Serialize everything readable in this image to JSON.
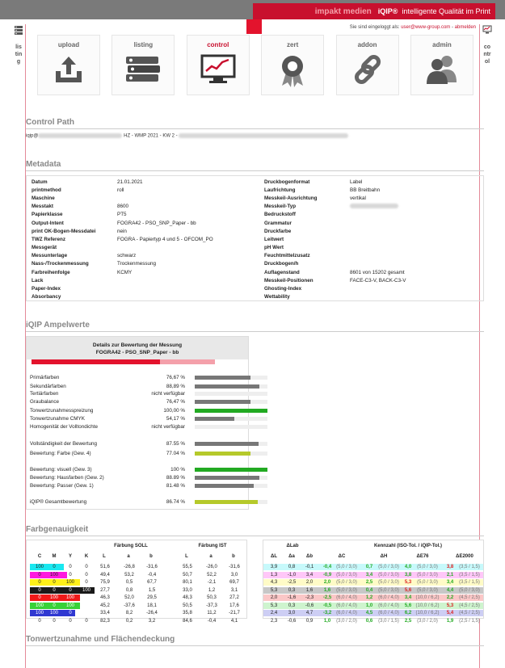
{
  "header": {
    "brand_left": "impakt medien",
    "brand_product": "iQIP®",
    "brand_tagline": "intelligente Qualität im Print"
  },
  "login": {
    "label": "Sie sind eingeloggt als:",
    "user": "user@www-group.com",
    "sep": "-",
    "logout": "abmelden"
  },
  "rails": {
    "left_label": "listing",
    "right_label": "control"
  },
  "nav": {
    "tiles": [
      {
        "label": "upload",
        "icon": "upload-icon",
        "active": false
      },
      {
        "label": "listing",
        "icon": "binders-icon",
        "active": false
      },
      {
        "label": "control",
        "icon": "monitor-chart-icon",
        "active": true
      },
      {
        "label": "zert",
        "icon": "certificate-icon",
        "active": false
      },
      {
        "label": "addon",
        "icon": "chain-link-icon",
        "active": false
      },
      {
        "label": "admin",
        "icon": "users-icon",
        "active": false
      }
    ]
  },
  "control_path": {
    "title": "Control Path",
    "prefix": "iqip@",
    "visible": "HZ - WMP 2021 - KW 2 -"
  },
  "metadata": {
    "title": "Metadata",
    "left": [
      {
        "k": "Datum",
        "v": "21.01.2021"
      },
      {
        "k": "printmethod",
        "v": "roll"
      },
      {
        "k": "Maschine",
        "v": ""
      },
      {
        "k": "Messtakt",
        "v": "8600"
      },
      {
        "k": "Papierklasse",
        "v": "PT5"
      },
      {
        "k": "Output-Intent",
        "v": "FOGRA42 - PSO_SNP_Paper - bb"
      },
      {
        "k": "print OK-Bogen-Messdatei",
        "v": "nein"
      },
      {
        "k": "TWZ Referenz",
        "v": "FOGRA - Papiertyp 4 und 5 - OFCOM_PO"
      },
      {
        "k": "Messgerät",
        "v": ""
      },
      {
        "k": "Messunterlage",
        "v": "schwarz"
      },
      {
        "k": "Nass-/Trockenmessung",
        "v": "Trockenmessung"
      },
      {
        "k": "Farbreihenfolge",
        "v": "KCMY"
      },
      {
        "k": "Lack",
        "v": ""
      },
      {
        "k": "Paper-Index",
        "v": ""
      },
      {
        "k": "Absorbancy",
        "v": ""
      }
    ],
    "right": [
      {
        "k": "Druckbogenformat",
        "v": "Label"
      },
      {
        "k": "Laufrichtung",
        "v": "BB Breitbahn"
      },
      {
        "k": "Messkeil-Ausrichtung",
        "v": "vertikal"
      },
      {
        "k": "Messkeil-Typ",
        "v": ""
      },
      {
        "k": "Bedruckstoff",
        "v": ""
      },
      {
        "k": "Grammatur",
        "v": ""
      },
      {
        "k": "Druckfarbe",
        "v": ""
      },
      {
        "k": "Leitwert",
        "v": ""
      },
      {
        "k": "pH Wert",
        "v": ""
      },
      {
        "k": "Feuchtmittelzusatz",
        "v": ""
      },
      {
        "k": "Druckbogen/h",
        "v": ""
      },
      {
        "k": "Auflagenstand",
        "v": "8601 von 15202 gesamt"
      },
      {
        "k": "Messkeil-Positionen",
        "v": "FACE-C3-V, BACK-C3-V"
      },
      {
        "k": "Ghosting-Index",
        "v": ""
      },
      {
        "k": "Wettability",
        "v": ""
      }
    ]
  },
  "ampel": {
    "title": "iQIP Ampelwerte",
    "head1": "Details zur Bewertung der Messung",
    "head2": "FOGRA42 - PSO_SNP_Paper - bb",
    "overall_fraction": 0.8674,
    "rows": [
      {
        "n": "Primärfarben",
        "p": "76,67 %",
        "f": 0.7667,
        "c": "#777777"
      },
      {
        "n": "Sekundärfarben",
        "p": "88,89 %",
        "f": 0.8889,
        "c": "#777777"
      },
      {
        "n": "Tertiärfarben",
        "p": "nicht verfügbar",
        "f": 0,
        "c": "#777777"
      },
      {
        "n": "Graubalance",
        "p": "76,47 %",
        "f": 0.7647,
        "c": "#777777"
      },
      {
        "n": "Tonwertzunahmesspreizung",
        "p": "100,00 %",
        "f": 1.0,
        "c": "#22aa22"
      },
      {
        "n": "Tonwertzunahme CMYK",
        "p": "54,17 %",
        "f": 0.5417,
        "c": "#777777"
      },
      {
        "n": "Homogenität der Volltondichte",
        "p": "nicht verfügbar",
        "f": 0,
        "c": "#777777"
      },
      {
        "n": "Vollständigkeit der Bewertung",
        "p": "87.55 %",
        "f": 0.8755,
        "c": "#777777"
      },
      {
        "n": "Bewertung: Farbe (Gew. 4)",
        "p": "77.04 %",
        "f": 0.7704,
        "c": "#b5c92a"
      },
      {
        "n": "Bewertung: visuell (Gew. 3)",
        "p": "100 %",
        "f": 1.0,
        "c": "#22aa22"
      },
      {
        "n": "Bewertung: Hausfarben (Gew. 2)",
        "p": "88.89 %",
        "f": 0.8889,
        "c": "#777777"
      },
      {
        "n": "Bewertung: Passer (Gew. 1)",
        "p": "81.48 %",
        "f": 0.8148,
        "c": "#777777"
      },
      {
        "n": "iQIP® Gesamtbewertung",
        "p": "86.74 %",
        "f": 0.8674,
        "c": "#b5c92a"
      }
    ]
  },
  "farb": {
    "title": "Farbgenauigkeit",
    "soll": "Färbung SOLL",
    "ist": "Färbung IST",
    "dlab": "ΔLab",
    "kenn": "Kennzahl (ISO-Tol. / iQIP-Tol.)",
    "cols": [
      "C",
      "M",
      "Y",
      "K",
      "L",
      "a",
      "b",
      "L",
      "a",
      "b"
    ],
    "cols2": [
      "ΔL",
      "Δa",
      "Δb",
      "ΔC",
      "ΔH",
      "ΔE76",
      "ΔE2000"
    ],
    "rows": [
      {
        "sw": "#00e5ee",
        "cmyk": [
          "100",
          "0",
          "0",
          "0"
        ],
        "v": [
          "51,6",
          "-26,8",
          "-31,6",
          "55,5",
          "-26,0",
          "-31,6"
        ],
        "d": [
          "3,9",
          "0,8",
          "-0,1"
        ],
        "k": [
          [
            "-0,4",
            "(5,0 / 3,0)",
            "g"
          ],
          [
            "0,7",
            "(5,0 / 3,0)",
            "g"
          ],
          [
            "4,0",
            "(5,0 / 3,0)",
            "g"
          ],
          [
            "3,8",
            "(3,5 / 1,5)",
            "r"
          ]
        ]
      },
      {
        "sw": "#ff00dd",
        "cmyk": [
          "0",
          "100",
          "0",
          "0"
        ],
        "v": [
          "49,4",
          "53,2",
          "-0,4",
          "50,7",
          "52,2",
          "3,0"
        ],
        "d": [
          "1,3",
          "-1,0",
          "3,4"
        ],
        "k": [
          [
            "-0,9",
            "(5,0 / 3,0)",
            "g"
          ],
          [
            "3,4",
            "(5,0 / 3,0)",
            "g"
          ],
          [
            "3,8",
            "(5,0 / 3,0)",
            "g"
          ],
          [
            "2,1",
            "(3,5 / 1,5)",
            "g"
          ]
        ]
      },
      {
        "sw": "#ffee00",
        "cmyk": [
          "0",
          "0",
          "100",
          "0"
        ],
        "v": [
          "75,9",
          "0,5",
          "67,7",
          "80,1",
          "-2,1",
          "69,7"
        ],
        "d": [
          "4,3",
          "-2,5",
          "2,0"
        ],
        "k": [
          [
            "2,0",
            "(5,0 / 3,0)",
            "g"
          ],
          [
            "2,5",
            "(5,0 / 3,0)",
            "g"
          ],
          [
            "5,3",
            "(5,0 / 3,0)",
            "r"
          ],
          [
            "3,4",
            "(3,5 / 1,5)",
            "g"
          ]
        ]
      },
      {
        "sw": "#000000",
        "cmyk": [
          "0",
          "0",
          "0",
          "100"
        ],
        "v": [
          "27,7",
          "0,8",
          "1,5",
          "33,0",
          "1,2",
          "3,1"
        ],
        "d": [
          "5,3",
          "0,3",
          "1,6"
        ],
        "k": [
          [
            "1,6",
            "(5,0 / 3,0)",
            "g"
          ],
          [
            "0,4",
            "(5,0 / 3,0)",
            "g"
          ],
          [
            "5,6",
            "(5,0 / 3,0)",
            "r"
          ],
          [
            "4,4",
            "(5,0 / 3,0)",
            "g"
          ]
        ]
      },
      {
        "sw": "#ee0000",
        "cmyk": [
          "0",
          "100",
          "100",
          "0"
        ],
        "v": [
          "46,3",
          "52,0",
          "29,5",
          "48,3",
          "50,3",
          "27,2"
        ],
        "d": [
          "2,0",
          "-1,6",
          "-2,3"
        ],
        "k": [
          [
            "-2,5",
            "(6,0 / 4,0)",
            "g"
          ],
          [
            "1,2",
            "(6,0 / 4,0)",
            "g"
          ],
          [
            "3,4",
            "(10,0 / 6,2)",
            "g"
          ],
          [
            "2,2",
            "(4,5 / 2,5)",
            "g"
          ]
        ]
      },
      {
        "sw": "#22cc22",
        "cmyk": [
          "100",
          "0",
          "100",
          "0"
        ],
        "v": [
          "45,2",
          "-37,6",
          "18,1",
          "50,5",
          "-37,3",
          "17,6"
        ],
        "d": [
          "5,3",
          "0,3",
          "-0,6"
        ],
        "k": [
          [
            "-0,5",
            "(6,0 / 4,0)",
            "g"
          ],
          [
            "1,0",
            "(6,0 / 4,0)",
            "g"
          ],
          [
            "5,6",
            "(10,0 / 6,2)",
            "g"
          ],
          [
            "5,3",
            "(4,5 / 2,5)",
            "r"
          ]
        ]
      },
      {
        "sw": "#1a22cc",
        "cmyk": [
          "100",
          "100",
          "0",
          "0"
        ],
        "v": [
          "33,4",
          "8,2",
          "-26,4",
          "35,8",
          "11,2",
          "-21,7"
        ],
        "d": [
          "2,4",
          "3,0",
          "4,7"
        ],
        "k": [
          [
            "-3,2",
            "(6,0 / 4,0)",
            "g"
          ],
          [
            "4,5",
            "(6,0 / 4,0)",
            "g"
          ],
          [
            "6,2",
            "(10,0 / 6,2)",
            "g"
          ],
          [
            "5,4",
            "(4,5 / 2,5)",
            "r"
          ]
        ]
      },
      {
        "sw": "#ffffff",
        "cmyk": [
          "0",
          "0",
          "0",
          "0"
        ],
        "v": [
          "82,3",
          "0,2",
          "3,2",
          "84,6",
          "-0,4",
          "4,1"
        ],
        "d": [
          "2,3",
          "-0,6",
          "0,9"
        ],
        "k": [
          [
            "1,0",
            "(3,0 / 2,0)",
            "g"
          ],
          [
            "0,6",
            "(3,0 / 1,5)",
            "g"
          ],
          [
            "2,5",
            "(3,0 / 2,0)",
            "g"
          ],
          [
            "1,9",
            "(2,5 / 1,5)",
            "g"
          ]
        ]
      }
    ]
  },
  "tonwert": {
    "title": "Tonwertzunahme und Flächendeckung"
  },
  "colors": {
    "brand_red": "#c8102e",
    "accent_red": "#e3132d",
    "good": "#22aa22",
    "bad": "#dd2222"
  }
}
